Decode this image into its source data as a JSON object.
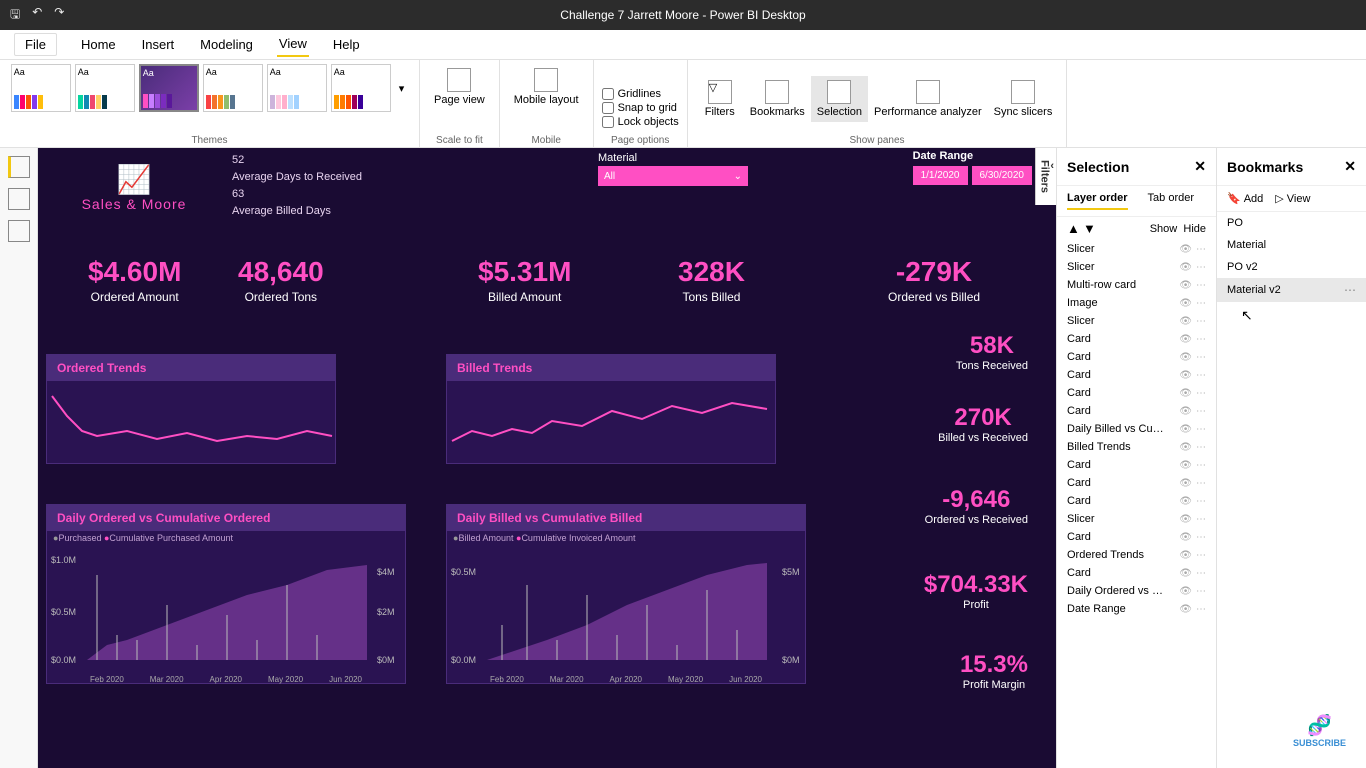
{
  "titlebar": {
    "title": "Challenge 7 Jarrett Moore - Power BI Desktop"
  },
  "menu": {
    "file": "File",
    "tabs": [
      "Home",
      "Insert",
      "Modeling",
      "View",
      "Help"
    ],
    "active": "View"
  },
  "ribbon": {
    "themes_label": "Themes",
    "scale_label": "Scale to fit",
    "mobile_label": "Mobile",
    "page_opts_label": "Page options",
    "show_panes_label": "Show panes",
    "page_view": "Page view",
    "mobile_layout": "Mobile layout",
    "gridlines": "Gridlines",
    "snap": "Snap to grid",
    "lock": "Lock objects",
    "filters": "Filters",
    "bookmarks": "Bookmarks",
    "selection": "Selection",
    "perf": "Performance analyzer",
    "sync": "Sync slicers",
    "theme_aa": "Aa"
  },
  "filters_tab": "Filters",
  "dash": {
    "brand": "Sales & Moore",
    "info": {
      "v1": "52",
      "l1": "Average Days to Received",
      "v2": "63",
      "l2": "Average Billed Days"
    },
    "material": {
      "label": "Material",
      "value": "All"
    },
    "date": {
      "label": "Date Range",
      "from": "1/1/2020",
      "to": "6/30/2020"
    },
    "kpi1": {
      "v": "$4.60M",
      "l": "Ordered Amount"
    },
    "kpi2": {
      "v": "48,640",
      "l": "Ordered Tons"
    },
    "kpi3": {
      "v": "$5.31M",
      "l": "Billed Amount"
    },
    "kpi4": {
      "v": "328K",
      "l": "Tons Billed"
    },
    "kpi5": {
      "v": "-279K",
      "l": "Ordered vs Billed"
    },
    "trend1": "Ordered Trends",
    "trend2": "Billed Trends",
    "combo1": {
      "title": "Daily Ordered vs Cumulative Ordered",
      "leg1": "Purchased",
      "leg2": "Cumulative Purchased Amount",
      "y1t": "$1.0M",
      "y1m": "$0.5M",
      "y1b": "$0.0M",
      "y2t": "$4M",
      "y2m": "$2M",
      "y2b": "$0M",
      "x1": "Feb 2020",
      "x2": "Mar 2020",
      "x3": "Apr 2020",
      "x4": "May 2020",
      "x5": "Jun 2020"
    },
    "combo2": {
      "title": "Daily Billed vs Cumulative Billed",
      "leg1": "Billed Amount",
      "leg2": "Cumulative Invoiced Amount",
      "y1t": "$0.5M",
      "y1b": "$0.0M",
      "y2t": "$5M",
      "y2b": "$0M",
      "x1": "Feb 2020",
      "x2": "Mar 2020",
      "x3": "Apr 2020",
      "x4": "May 2020",
      "x5": "Jun 2020"
    },
    "r1": {
      "v": "58K",
      "l": "Tons Received"
    },
    "r2": {
      "v": "270K",
      "l": "Billed vs Received"
    },
    "r3": {
      "v": "-9,646",
      "l": "Ordered vs Received"
    },
    "r4": {
      "v": "$704.33K",
      "l": "Profit"
    },
    "r5": {
      "v": "15.3%",
      "l": "Profit Margin"
    }
  },
  "selection": {
    "title": "Selection",
    "tab1": "Layer order",
    "tab2": "Tab order",
    "show": "Show",
    "hide": "Hide",
    "items": [
      "Slicer",
      "Slicer",
      "Multi-row card",
      "Image",
      "Slicer",
      "Card",
      "Card",
      "Card",
      "Card",
      "Card",
      "Daily Billed vs Cumul...",
      "Billed Trends",
      "Card",
      "Card",
      "Card",
      "Slicer",
      "Card",
      "Ordered Trends",
      "Card",
      "Daily Ordered vs Cu...",
      "Date Range"
    ]
  },
  "bookmarks": {
    "title": "Bookmarks",
    "add": "Add",
    "view": "View",
    "items": [
      "PO",
      "Material",
      "PO v2",
      "Material v2"
    ],
    "selected": "Material v2"
  },
  "subscribe": "SUBSCRIBE"
}
